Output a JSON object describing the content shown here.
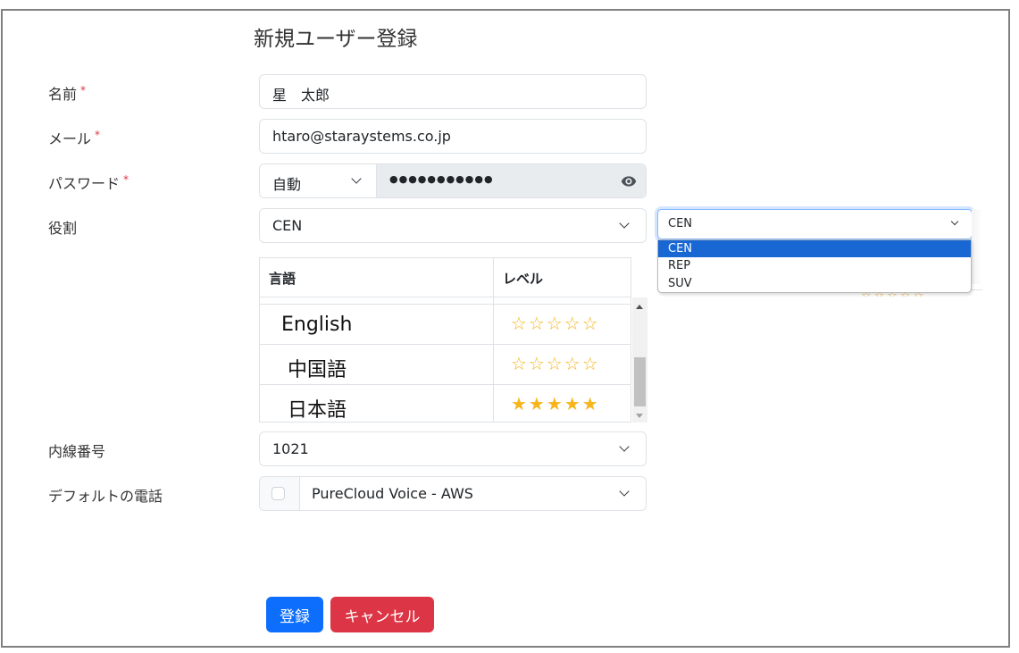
{
  "page": {
    "title": "新規ユーザー登録"
  },
  "form": {
    "name": {
      "label": "名前",
      "required_mark": "*",
      "value": "星　太郎"
    },
    "email": {
      "label": "メール",
      "required_mark": "*",
      "value": "htaro@staraystems.co.jp"
    },
    "password": {
      "label": "パスワード",
      "required_mark": "*",
      "mode": "自動",
      "masked_value": "●●●●●●●●●●●",
      "reveal_icon": "eye-icon"
    },
    "role": {
      "label": "役割",
      "value": "CEN",
      "open_dropdown": {
        "value": "CEN",
        "options": [
          {
            "label": "CEN",
            "selected": true
          },
          {
            "label": "REP",
            "selected": false
          },
          {
            "label": "SUV",
            "selected": false
          }
        ]
      }
    },
    "languages": {
      "headers": [
        "言語",
        "レベル"
      ],
      "max_rating": 5,
      "rows": [
        {
          "language": "English",
          "rating": 0,
          "stars": "☆☆☆☆☆"
        },
        {
          "language": "中国語",
          "rating": 0,
          "stars": "☆☆☆☆☆"
        },
        {
          "language": "日本語",
          "rating": 5,
          "stars": "★★★★★"
        }
      ],
      "ghost_stars": "☆☆☆☆☆"
    },
    "extension": {
      "label": "内線番号",
      "value": "1021"
    },
    "default_phone": {
      "label": "デフォルトの電話",
      "checked": false,
      "value": "PureCloud Voice - AWS"
    }
  },
  "buttons": {
    "submit": "登録",
    "cancel": "キャンセル"
  },
  "colors": {
    "primary": "#0d6efd",
    "danger": "#dc3545",
    "star": "#f6b51c",
    "dropdown_selected": "#1967d2"
  }
}
